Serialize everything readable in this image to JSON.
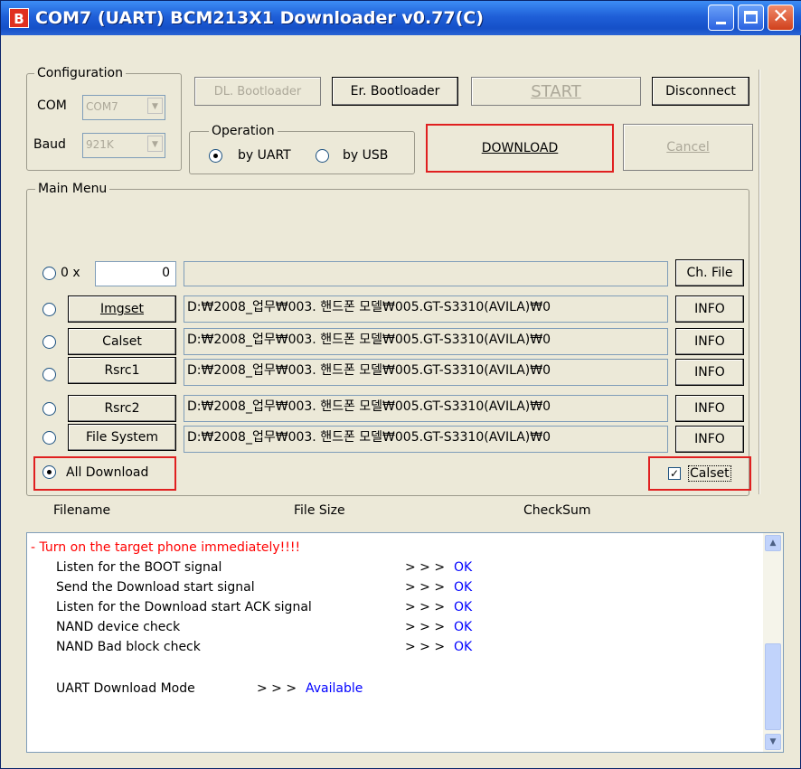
{
  "window": {
    "icon_letter": "B",
    "title": "COM7 (UART)   BCM213X1 Downloader v0.77(C)"
  },
  "config": {
    "label": "Configuration",
    "com_label": "COM",
    "com_value": "COM7",
    "baud_label": "Baud",
    "baud_value": "921K"
  },
  "toolbar": {
    "dl_bootloader": "DL. Bootloader",
    "er_bootloader": "Er. Bootloader",
    "start": "START",
    "disconnect": "Disconnect",
    "download": "DOWNLOAD",
    "cancel": "Cancel"
  },
  "operation": {
    "label": "Operation",
    "by_uart": "by UART",
    "by_usb": "by USB",
    "selected": "by UART"
  },
  "main_menu": {
    "label": "Main Menu",
    "hex_prefix": "0 x",
    "hex_value": "0",
    "ch_file": "Ch. File",
    "items": [
      {
        "name": "Imgset",
        "path": "D:₩2008_업무₩003. 핸드폰 모델₩005.GT-S3310(AVILA)₩0",
        "info": "INFO"
      },
      {
        "name": "Calset",
        "path": "D:₩2008_업무₩003. 핸드폰 모델₩005.GT-S3310(AVILA)₩0",
        "info": "INFO"
      },
      {
        "name": "Rsrc1",
        "path": "D:₩2008_업무₩003. 핸드폰 모델₩005.GT-S3310(AVILA)₩0",
        "info": "INFO"
      },
      {
        "name": "Rsrc2",
        "path": "D:₩2008_업무₩003. 핸드폰 모델₩005.GT-S3310(AVILA)₩0",
        "info": "INFO"
      },
      {
        "name": "File System",
        "path": "D:₩2008_업무₩003. 핸드폰 모델₩005.GT-S3310(AVILA)₩0",
        "info": "INFO"
      }
    ],
    "all_download": "All Download",
    "calset_check": "Calset",
    "calset_checked": true
  },
  "columns": {
    "filename": "Filename",
    "file_size": "File Size",
    "checksum": "CheckSum"
  },
  "log": {
    "warning": "- Turn on the target phone immediately!!!!",
    "steps": [
      {
        "text": "Listen for the BOOT signal",
        "arrow": "> > >",
        "status": "OK"
      },
      {
        "text": "Send the Download start signal",
        "arrow": "> > >",
        "status": "OK"
      },
      {
        "text": "Listen for the Download start ACK signal",
        "arrow": "> > >",
        "status": "OK"
      },
      {
        "text": "NAND device check",
        "arrow": "> > >",
        "status": "OK"
      },
      {
        "text": "NAND Bad block check",
        "arrow": "> > >",
        "status": "OK"
      }
    ],
    "mode_text": "UART Download Mode",
    "mode_arrow": "> > >",
    "mode_status": "Available"
  },
  "colors": {
    "title_bar": "#1f5fd8",
    "highlight_box": "#e02020",
    "warning_text": "#ff0000",
    "status_text": "#0000ff"
  }
}
